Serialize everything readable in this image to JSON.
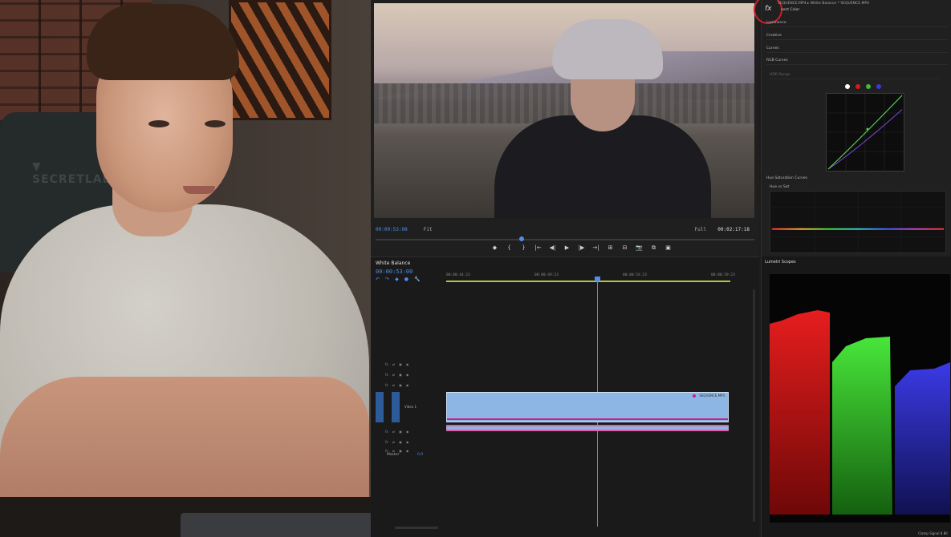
{
  "program": {
    "timecode": "00:00:53:08",
    "fit": "Fit",
    "quality": "Full",
    "duration": "00:02:17:18",
    "transport": [
      "◆",
      "{",
      "}",
      "|←",
      "◀|",
      "▶",
      "|▶",
      "→|",
      "⊞",
      "⊟",
      "📷",
      "⧉",
      "▣"
    ],
    "progress": 0.38
  },
  "timeline": {
    "tab": "White Balance",
    "timecode": "00:00:53:00",
    "ruler": [
      "00:00:44:23",
      "00:00:49:23",
      "00:00:54:23",
      "00:00:59:23"
    ],
    "track_label": "Video 1",
    "master_label": "Master",
    "master_value": "0.0",
    "clip_name": "SEQUENCE.MP4",
    "tools": [
      "↶",
      "↷",
      "◆",
      "●",
      "🔧"
    ]
  },
  "lumetri": {
    "fx_label": "fx",
    "header": "SEQUENCE.MP4  ▸  White Balance * SEQUENCE.MP4",
    "subheader": "vent Color",
    "sections": [
      "Luminance",
      "Creative",
      "Curves",
      "RGB Curves",
      "HDR Range"
    ],
    "hsc_title": "Hue Saturation Curves",
    "hsc_sub": "Hue vs Sat",
    "swatch_colors": [
      "#ffffff",
      "#d01c1c",
      "#3bbd3b",
      "#3a3ad8"
    ]
  },
  "scopes": {
    "title": "Lumetri Scopes",
    "footer": "Clamp Signal  8 Bit"
  }
}
